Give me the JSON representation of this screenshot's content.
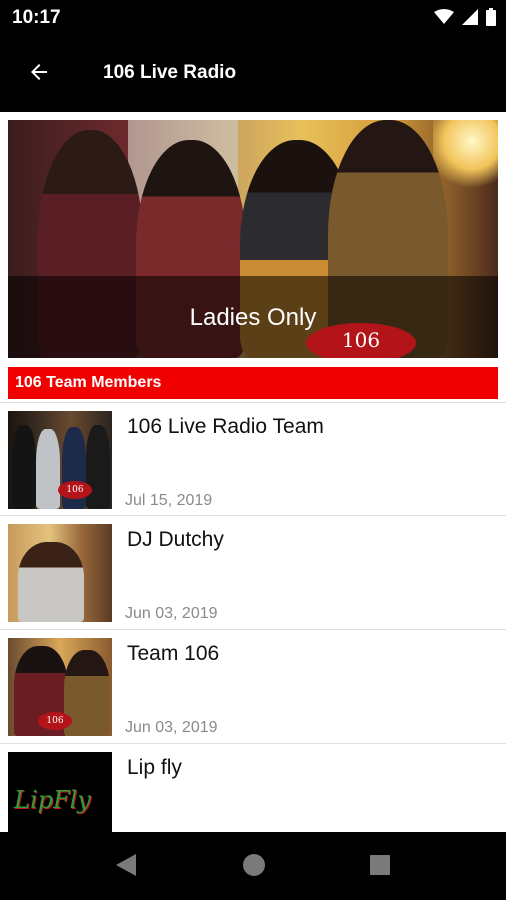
{
  "status_bar": {
    "time": "10:17",
    "icons": [
      "wifi-icon",
      "cellular-signal-icon",
      "battery-icon"
    ]
  },
  "app_bar": {
    "back_icon": "arrow-back-icon",
    "title": "106 Live Radio"
  },
  "banner": {
    "caption": "Ladies Only",
    "logo_text": "106"
  },
  "section": {
    "title": "106 Team Members",
    "color": "#f00000"
  },
  "items": [
    {
      "title": "106 Live Radio Team",
      "date": "Jul 15, 2019",
      "thumb_logo": "106"
    },
    {
      "title": "DJ Dutchy",
      "date": "Jun 03, 2019"
    },
    {
      "title": "Team 106",
      "date": "Jun 03, 2019",
      "thumb_logo": "106"
    },
    {
      "title": "Lip fly",
      "date": "",
      "thumb_logo": "LipFly"
    }
  ],
  "nav_bar": {
    "buttons": [
      "back-triangle-icon",
      "home-circle-icon",
      "recents-square-icon"
    ]
  }
}
